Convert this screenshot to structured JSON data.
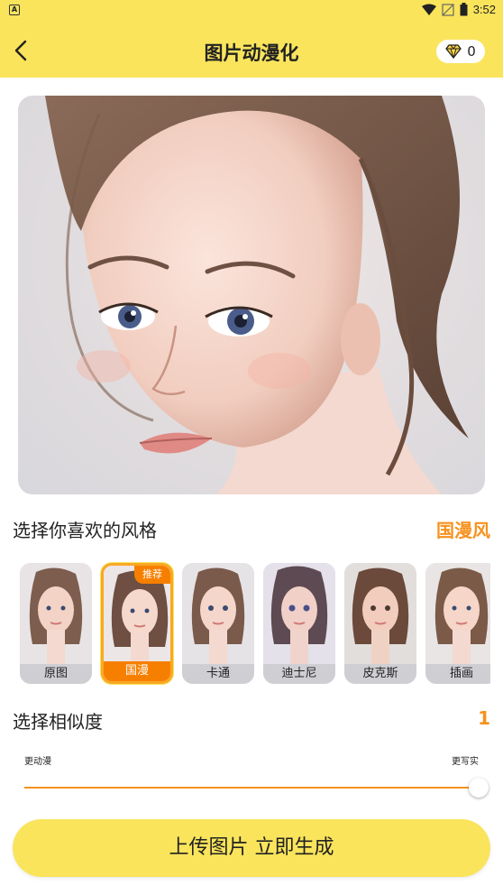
{
  "status_bar": {
    "left_icon": "A",
    "time": "3:52"
  },
  "header": {
    "title": "图片动漫化",
    "gem_count": "0"
  },
  "style_section": {
    "title": "选择你喜欢的风格",
    "selected_value": "国漫风",
    "items": [
      {
        "label": "原图"
      },
      {
        "label": "国漫",
        "badge": "推荐",
        "selected": true
      },
      {
        "label": "卡通"
      },
      {
        "label": "迪士尼"
      },
      {
        "label": "皮克斯"
      },
      {
        "label": "插画"
      }
    ]
  },
  "similarity_section": {
    "title": "选择相似度",
    "value": "1",
    "min_label": "更动漫",
    "max_label": "更写实",
    "level": 1.0
  },
  "cta": {
    "label": "上传图片 立即生成"
  },
  "colors": {
    "accent_yellow": "#F9E45C",
    "accent_orange": "#F7921E"
  }
}
